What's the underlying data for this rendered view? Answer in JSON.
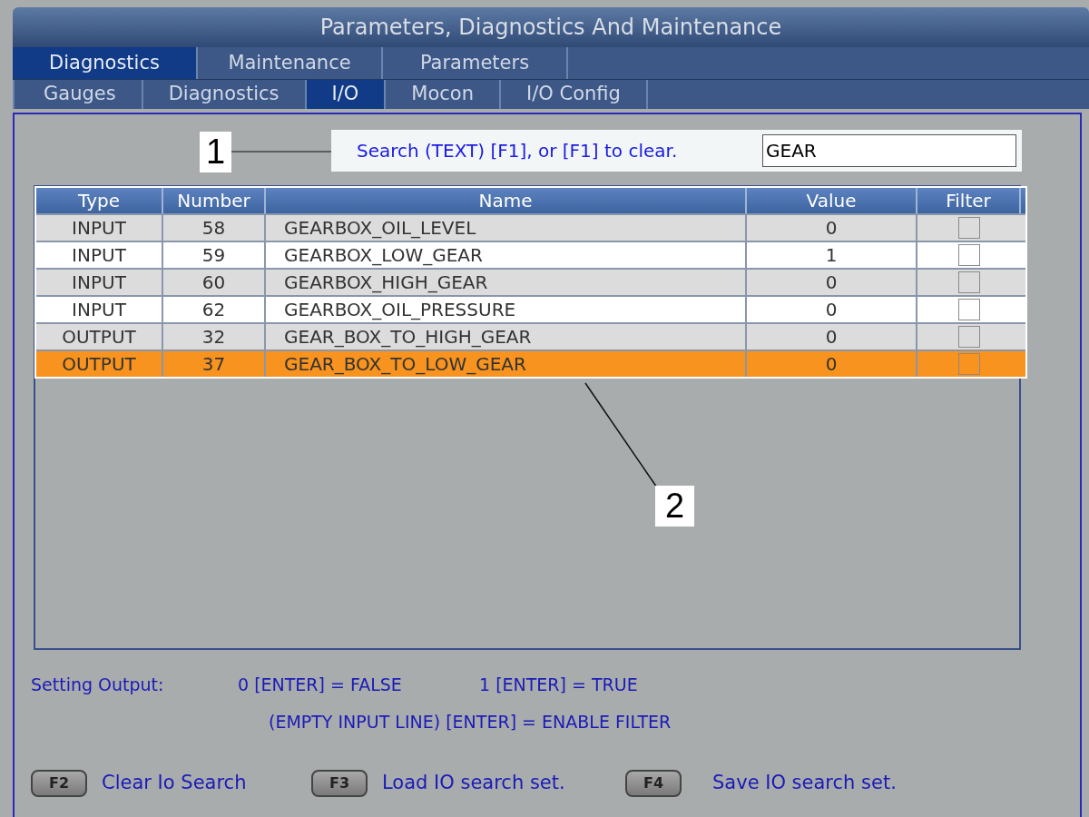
{
  "window": {
    "title": "Parameters, Diagnostics And Maintenance"
  },
  "main_tabs": [
    {
      "label": "Diagnostics",
      "selected": true
    },
    {
      "label": "Maintenance",
      "selected": false
    },
    {
      "label": "Parameters",
      "selected": false
    }
  ],
  "sub_tabs": [
    {
      "label": "Gauges",
      "selected": false
    },
    {
      "label": "Diagnostics",
      "selected": false
    },
    {
      "label": "I/O",
      "selected": true
    },
    {
      "label": "Mocon",
      "selected": false
    },
    {
      "label": "I/O Config",
      "selected": false
    }
  ],
  "search": {
    "label": "Search (TEXT) [F1], or [F1] to clear.",
    "value": "GEAR"
  },
  "table": {
    "columns": [
      "Type",
      "Number",
      "Name",
      "Value",
      "Filter"
    ],
    "rows": [
      {
        "type": "INPUT",
        "number": "58",
        "name": "GEARBOX_OIL_LEVEL",
        "value": "0",
        "filter": false,
        "selected": false
      },
      {
        "type": "INPUT",
        "number": "59",
        "name": "GEARBOX_LOW_GEAR",
        "value": "1",
        "filter": false,
        "selected": false
      },
      {
        "type": "INPUT",
        "number": "60",
        "name": "GEARBOX_HIGH_GEAR",
        "value": "0",
        "filter": false,
        "selected": false
      },
      {
        "type": "INPUT",
        "number": "62",
        "name": "GEARBOX_OIL_PRESSURE",
        "value": "0",
        "filter": false,
        "selected": false
      },
      {
        "type": "OUTPUT",
        "number": "32",
        "name": "GEAR_BOX_TO_HIGH_GEAR",
        "value": "0",
        "filter": false,
        "selected": false
      },
      {
        "type": "OUTPUT",
        "number": "37",
        "name": "GEAR_BOX_TO_LOW_GEAR",
        "value": "0",
        "filter": false,
        "selected": true
      }
    ]
  },
  "help": {
    "label": "Setting Output:",
    "false_hint": "0 [ENTER] = FALSE",
    "true_hint": "1 [ENTER] = TRUE",
    "filter_hint": "(EMPTY INPUT LINE) [ENTER] = ENABLE FILTER"
  },
  "function_keys": [
    {
      "key": "F2",
      "label": "Clear Io Search"
    },
    {
      "key": "F3",
      "label": "Load IO search set."
    },
    {
      "key": "F4",
      "label": "Save IO search set."
    }
  ],
  "callouts": [
    "1",
    "2"
  ]
}
